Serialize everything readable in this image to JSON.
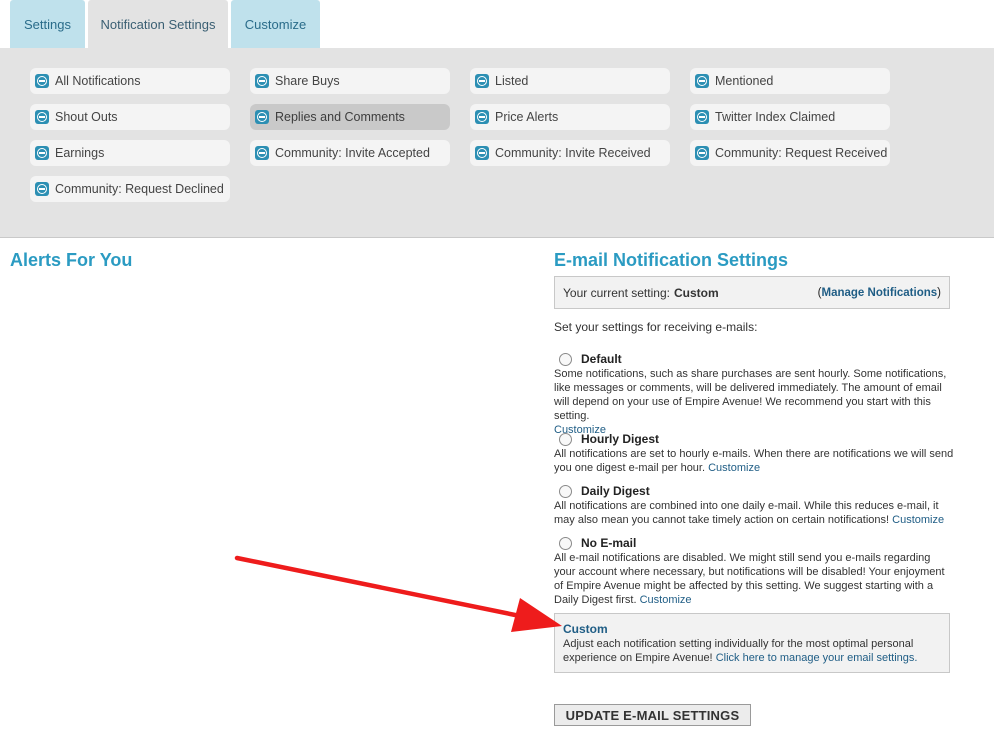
{
  "tabs": [
    "Settings",
    "Notification Settings",
    "Customize"
  ],
  "filters": {
    "items": [
      "All Notifications",
      "Share Buys",
      "Listed",
      "Mentioned",
      "Shout Outs",
      "Replies and Comments",
      "Price Alerts",
      "Twitter Index Claimed",
      "Earnings",
      "Community: Invite Accepted",
      "Community: Invite Received",
      "Community: Request Received",
      "Community: Request Declined"
    ],
    "selected": "Replies and Comments",
    "icon": "empire-avenue-e-icon"
  },
  "alerts": {
    "heading": "Alerts For You"
  },
  "email": {
    "heading": "E-mail Notification Settings",
    "current_label": "Your current setting:",
    "current_value": "Custom",
    "manage_open": "(",
    "manage_link": "Manage Notifications",
    "manage_close": ")",
    "intro": "Set your settings for receiving e-mails:",
    "options": [
      {
        "title": "Default",
        "desc": "Some notifications, such as share purchases are sent hourly. Some notifications, like messages or comments, will be delivered immediately. The amount of email will depend on your use of Empire Avenue! We recommend you start with this setting.",
        "link": "Customize"
      },
      {
        "title": "Hourly Digest",
        "desc": "All notifications are set to hourly e-mails. When there are notifications we will send you one digest e-mail per hour.",
        "link": "Customize"
      },
      {
        "title": "Daily Digest",
        "desc": "All notifications are combined into one daily e-mail. While this reduces e-mail, it may also mean you cannot take timely action on certain notifications!",
        "link": "Customize"
      },
      {
        "title": "No E-mail",
        "desc": "All e-mail notifications are disabled. We might still send you e-mails regarding your account where necessary, but notifications will be disabled! Your enjoyment of Empire Avenue might be affected by this setting. We suggest starting with a Daily Digest first.",
        "link": "Customize"
      }
    ],
    "custom": {
      "title": "Custom",
      "desc": "Adjust each notification setting individually for the most optimal personal experience on Empire Avenue!",
      "link": "Click here to manage your email settings."
    },
    "button": "UPDATE E-MAIL SETTINGS"
  },
  "colors": {
    "accent": "#2b9bc2",
    "link": "#1f5d85",
    "tab": "#bfe1ec",
    "panel": "#e3e3e3",
    "arrow": "#ee1c1c"
  }
}
